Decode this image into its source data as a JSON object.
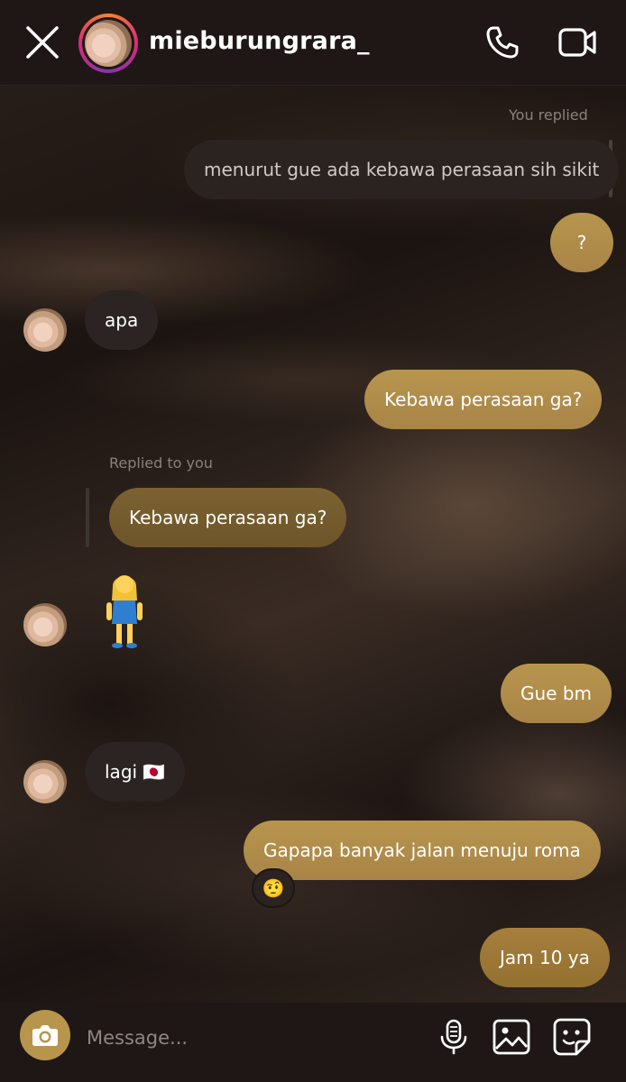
{
  "header": {
    "username": "mieburungrara_"
  },
  "labels": {
    "you_replied": "You replied",
    "replied_to_you": "Replied to you"
  },
  "messages": [
    {
      "from": "me-quoted",
      "text": "menurut gue ada kebawa perasaan sih sikit"
    },
    {
      "from": "me",
      "text": "?"
    },
    {
      "from": "them",
      "text": "apa"
    },
    {
      "from": "me",
      "text": "Kebawa perasaan ga?"
    },
    {
      "from": "them-quoted",
      "text": "Kebawa perasaan ga?"
    },
    {
      "from": "them",
      "text": "🙍‍♀️"
    },
    {
      "from": "me",
      "text": "Gue bm"
    },
    {
      "from": "them",
      "text": "lagi 🇯🇵"
    },
    {
      "from": "me",
      "text": "Gapapa banyak jalan menuju roma"
    },
    {
      "from": "me",
      "text": "Jam 10 ya"
    }
  ],
  "reaction": "🤨",
  "composer": {
    "placeholder": "Message..."
  },
  "icons": [
    "close-icon",
    "phone-icon",
    "video-icon",
    "camera-icon",
    "microphone-icon",
    "gallery-icon",
    "sticker-icon"
  ],
  "colors": {
    "accent": "#b8954d",
    "header_bg": "#1e1716"
  }
}
